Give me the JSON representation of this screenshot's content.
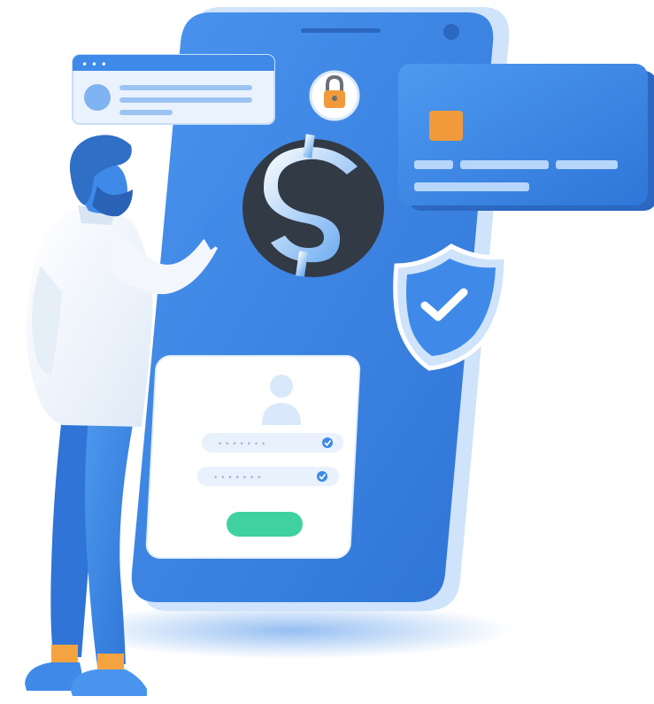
{
  "illustration": {
    "icons": [
      "padlock-icon",
      "dollar-icon",
      "shield-check-icon",
      "checkmark-icon",
      "user-avatar-icon",
      "credit-card-chip-icon"
    ],
    "colors": {
      "phone_blue": "#3f8ae8",
      "phone_light": "#d7e9fb",
      "card_blue": "#3f8ae8",
      "chip_orange": "#f09a3b",
      "coin_dark": "#323a45",
      "login_button_green": "#3fd1a0",
      "shoe_orange": "#f4a340",
      "pants_blue": "#3e8ce6",
      "hair_blue": "#2f6fc5"
    },
    "login_form": {
      "password_mask_1": "• • • • • • •",
      "password_mask_2": "• • • • • • •"
    },
    "browser_window": {
      "dots": "• • •"
    }
  }
}
